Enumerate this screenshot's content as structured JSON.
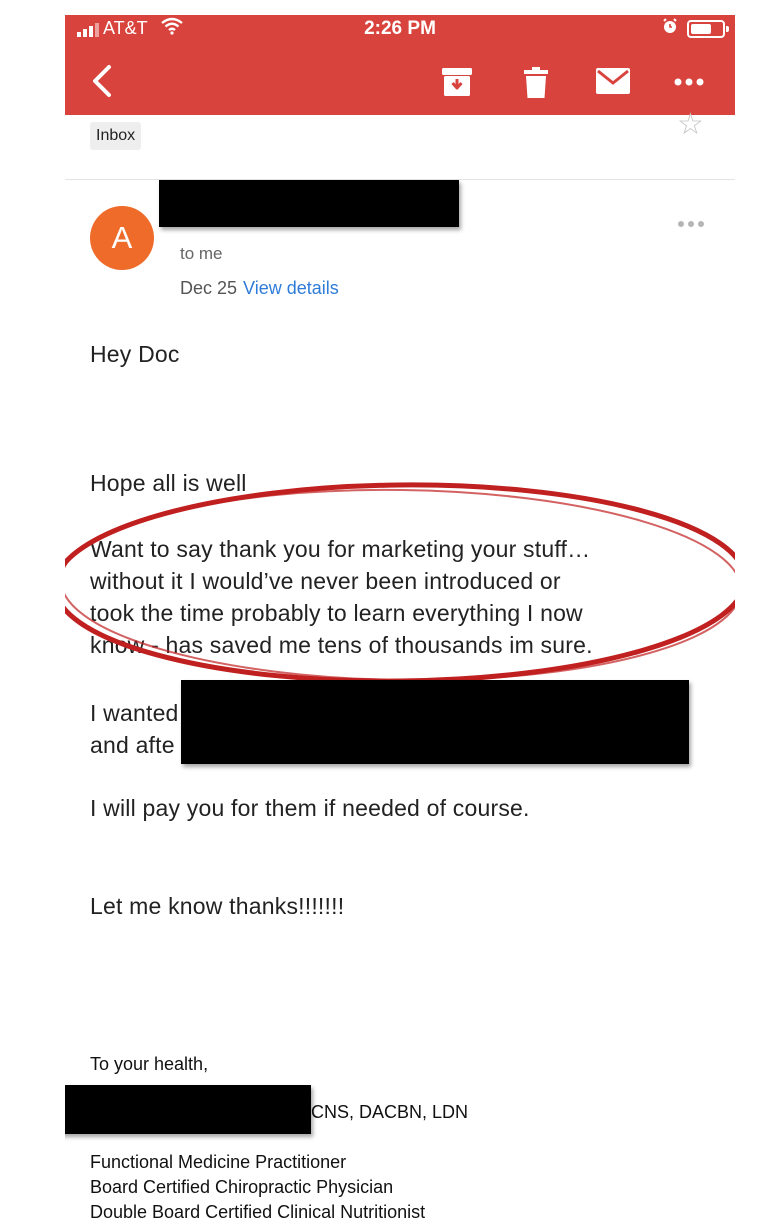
{
  "status_bar": {
    "carrier": "AT&T",
    "time": "2:26 PM"
  },
  "toolbar": {
    "back_icon": "chevron-left-icon",
    "archive_icon": "archive-icon",
    "delete_icon": "trash-icon",
    "mark_unread_icon": "mail-icon",
    "more_icon": "more-horizontal-icon"
  },
  "message": {
    "label": "Inbox",
    "avatar_letter": "A",
    "recipient": "to me",
    "date": "Dec 25",
    "view_details": "View details",
    "body": {
      "greeting": "Hey Doc",
      "line_hope": "Hope all is well",
      "highlight": "Want to say thank you for marketing your stuff…\nwithout it I would’ve never been introduced or\ntook the time probably to learn everything I now\nknow - has saved me tens of thousands im sure.",
      "request": "I wanted\nand afte",
      "pay": "I will pay you for them if needed of course.",
      "thanks": "Let me know thanks!!!!!!!"
    },
    "signature": {
      "closing": "To your health,",
      "credentials": "CNS, DACBN, LDN",
      "title_1": "Functional Medicine Practitioner",
      "title_2": "Board Certified Chiropractic Physician",
      "title_3": "Double Board Certified Clinical Nutritionist"
    }
  },
  "colors": {
    "app_bar": "#d9433d",
    "avatar": "#ee6b2a",
    "link": "#2f7cd8",
    "annotation_oval": "#c0201f"
  }
}
